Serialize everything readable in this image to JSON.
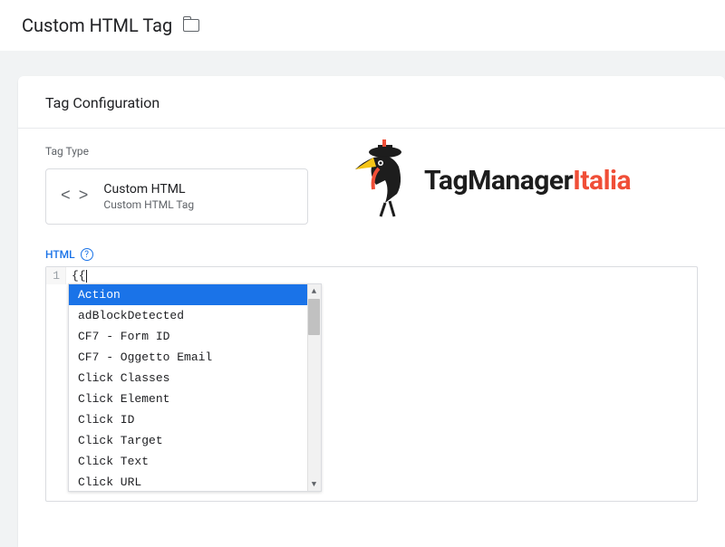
{
  "header": {
    "title": "Custom HTML Tag"
  },
  "panel": {
    "title": "Tag Configuration"
  },
  "tagType": {
    "sectionLabel": "Tag Type",
    "name": "Custom HTML",
    "sub": "Custom HTML Tag"
  },
  "editor": {
    "label": "HTML",
    "lineNumber": "1",
    "content": "{{"
  },
  "autocomplete": {
    "items": [
      "Action",
      "adBlockDetected",
      "CF7 - Form ID",
      "CF7 - Oggetto Email",
      "Click Classes",
      "Click Element",
      "Click ID",
      "Click Target",
      "Click Text",
      "Click URL"
    ],
    "selectedIndex": 0
  },
  "logo": {
    "text1": "TagManager",
    "text2": "Italia"
  }
}
